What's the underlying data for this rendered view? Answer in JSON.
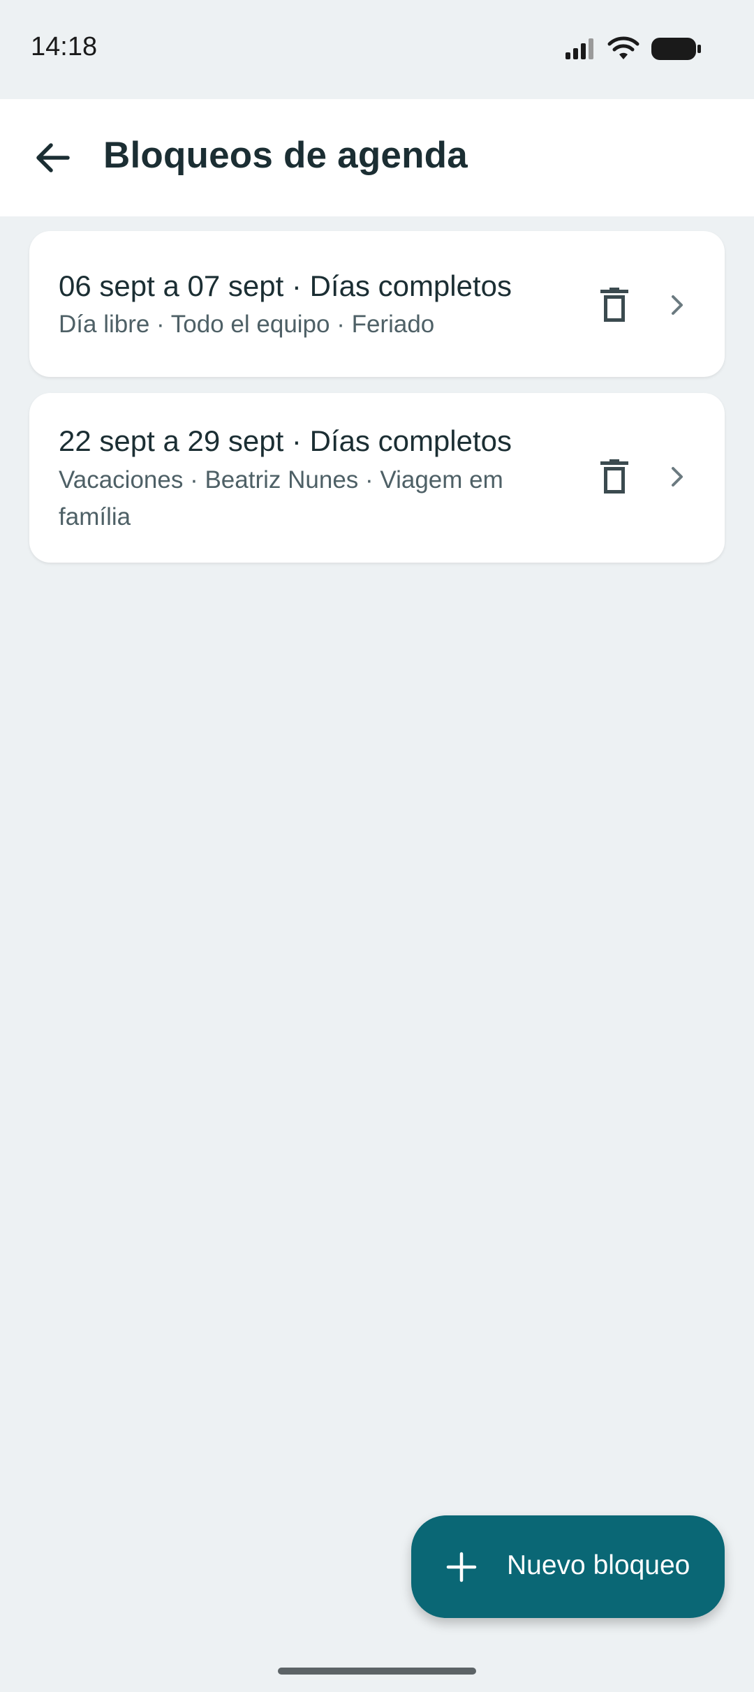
{
  "status_bar": {
    "time": "14:18",
    "icons": [
      "signal-icon",
      "wifi-icon",
      "battery-icon"
    ]
  },
  "header": {
    "title": "Bloqueos de agenda",
    "back_icon": "arrow-back-icon"
  },
  "blocks": [
    {
      "title": "06 sept a 07 sept · Días completos",
      "subtitle": "Día libre · Todo el equipo · Feriado"
    },
    {
      "title": "22 sept a 29 sept · Días completos",
      "subtitle": "Vacaciones · Beatriz Nunes · Viagem em família"
    }
  ],
  "fab": {
    "label": "Nuevo bloqueo",
    "icon": "plus-icon"
  },
  "colors": {
    "background": "#edf1f3",
    "accent": "#0a6775",
    "text_primary": "#1b2e33",
    "text_secondary": "#4e6066"
  }
}
